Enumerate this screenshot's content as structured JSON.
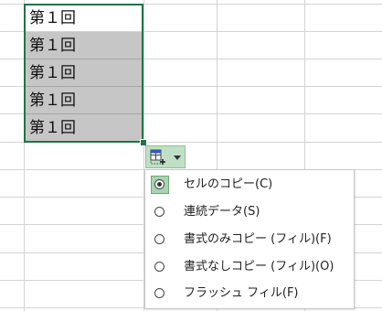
{
  "spreadsheet": {
    "cells": [
      {
        "value": "第１回"
      },
      {
        "value": "第１回"
      },
      {
        "value": "第１回"
      },
      {
        "value": "第１回"
      },
      {
        "value": "第１回"
      }
    ]
  },
  "autofill_button": {
    "icon": "autofill-options-icon",
    "dropdown_icon": "caret-down-icon"
  },
  "autofill_menu": {
    "items": [
      {
        "label": "セルのコピー(C)",
        "selected": true
      },
      {
        "label": "連続データ(S)",
        "selected": false
      },
      {
        "label": "書式のみコピー (フィル)(F)",
        "selected": false
      },
      {
        "label": "書式なしコピー (フィル)(O)",
        "selected": false
      },
      {
        "label": "フラッシュ フィル(F)",
        "selected": false
      }
    ]
  },
  "colors": {
    "selection_border": "#217346",
    "selection_fill": "#c6c6c6",
    "button_fill": "#bfe0c6"
  }
}
